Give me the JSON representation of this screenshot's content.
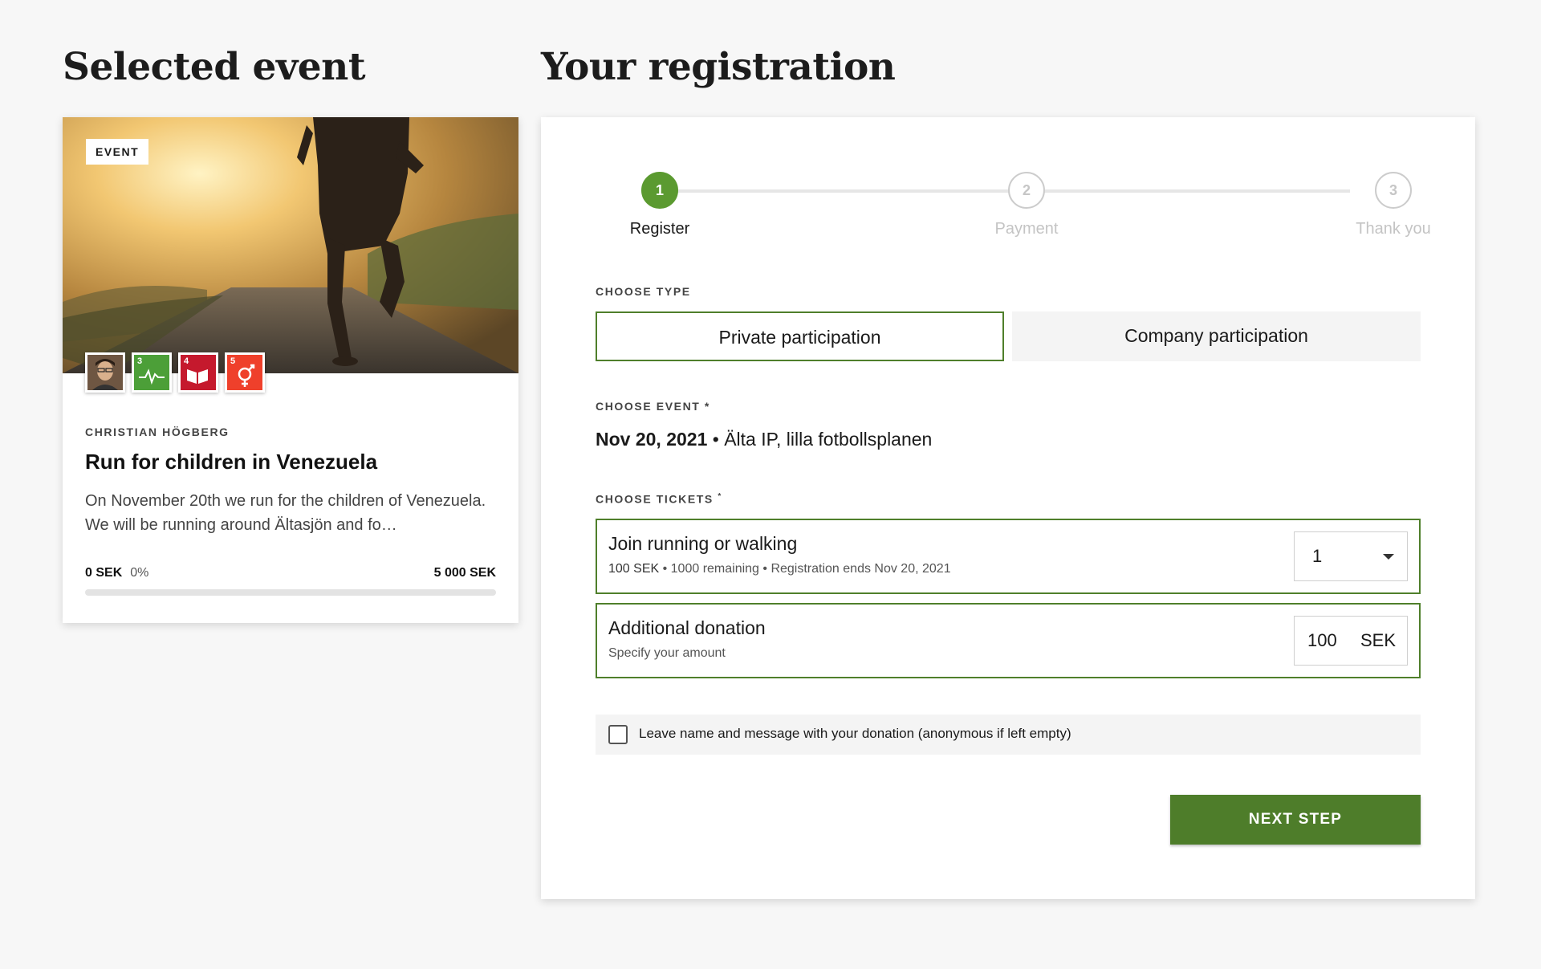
{
  "headings": {
    "left": "Selected event",
    "right": "Your registration"
  },
  "event_card": {
    "tag": "EVENT",
    "organizer": "CHRISTIAN HÖGBERG",
    "title": "Run for children in Venezuela",
    "description": "On November 20th we run for the children of Venezuela. We will be running around Ältasjön and fo…",
    "raised": "0 SEK",
    "percent": "0%",
    "progress_fraction": 0.0,
    "goal": "5 000 SEK",
    "badges": [
      {
        "icon": "organizer-avatar-icon",
        "color": "#7a5a44"
      },
      {
        "icon": "sdg-3-health-icon",
        "number": "3",
        "color": "#4c9f38"
      },
      {
        "icon": "sdg-4-education-icon",
        "number": "4",
        "color": "#c5192d"
      },
      {
        "icon": "sdg-5-gender-equality-icon",
        "number": "5",
        "color": "#ef402b"
      }
    ]
  },
  "stepper": {
    "steps": [
      {
        "number": "1",
        "label": "Register",
        "active": true
      },
      {
        "number": "2",
        "label": "Payment",
        "active": false
      },
      {
        "number": "3",
        "label": "Thank you",
        "active": false
      }
    ]
  },
  "choose_type": {
    "label": "CHOOSE TYPE",
    "options": [
      "Private participation",
      "Company participation"
    ],
    "selected": "Private participation"
  },
  "choose_event": {
    "label": "CHOOSE EVENT *",
    "date": "Nov 20, 2021",
    "separator": "•",
    "location": "Älta IP, lilla fotbollsplanen"
  },
  "choose_tickets": {
    "label": "CHOOSE TICKETS",
    "required_mark": "*",
    "ticket": {
      "title": "Join running or walking",
      "price": "100 SEK",
      "details": "• 1000 remaining • Registration ends Nov 20, 2021",
      "quantity": "1"
    },
    "donation": {
      "title": "Additional donation",
      "subtitle": "Specify your amount",
      "amount": "100",
      "currency": "SEK"
    }
  },
  "anonymous": {
    "label": "Leave name and message with your donation (anonymous if left empty)",
    "checked": false
  },
  "next_button": "NEXT STEP",
  "colors": {
    "accent": "#5b9a30",
    "button": "#4e7d2a",
    "border": "#4f7f2b"
  }
}
